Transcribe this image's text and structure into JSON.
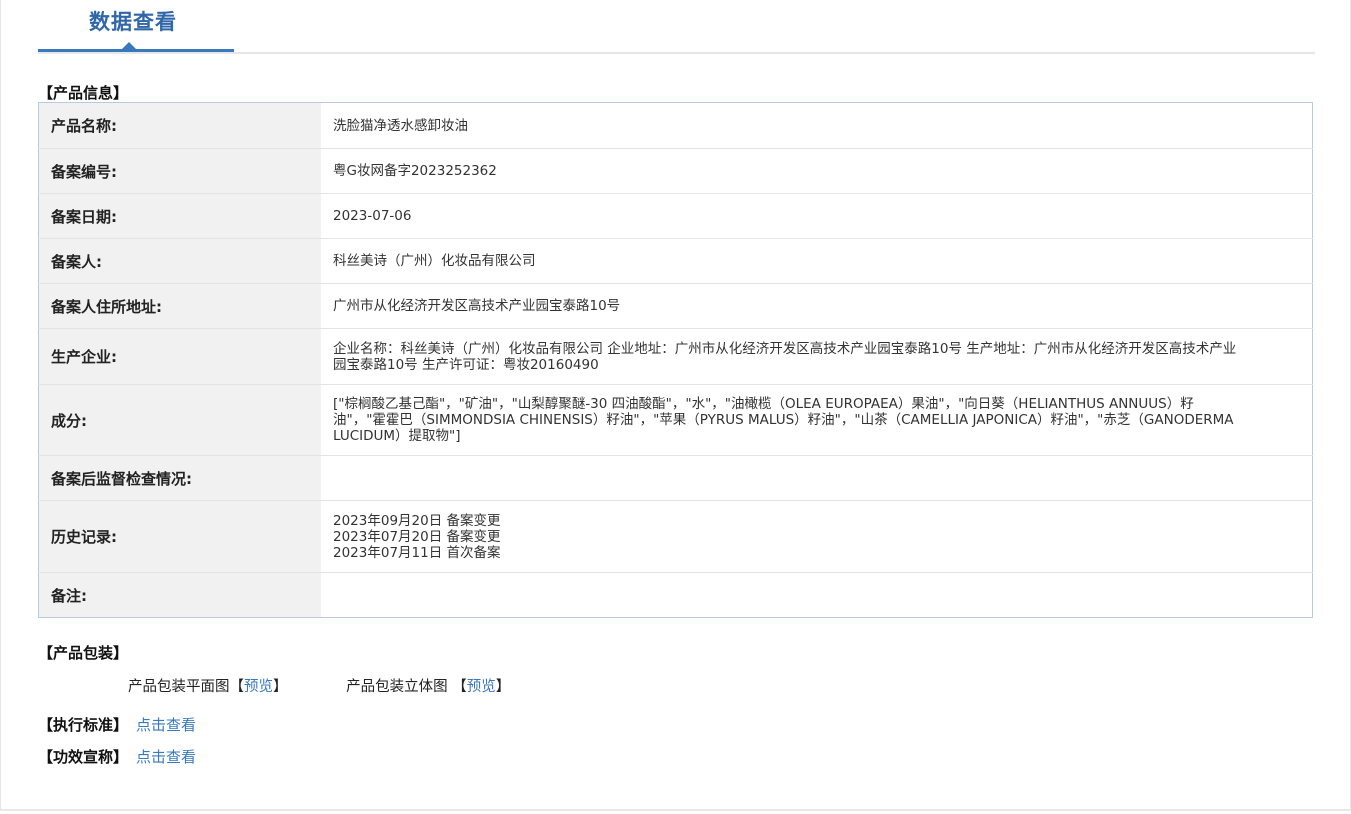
{
  "tab": {
    "title": "数据查看"
  },
  "product_info": {
    "heading": "【产品信息】",
    "rows": [
      {
        "label": "产品名称:",
        "value": "洗脸猫净透水感卸妆油",
        "height": 46
      },
      {
        "label": "备案编号:",
        "value": "粤G妆网备字2023252362",
        "height": 45
      },
      {
        "label": "备案日期:",
        "value": "2023-07-06",
        "height": 45
      },
      {
        "label": "备案人:",
        "value": "科丝美诗（广州）化妆品有限公司",
        "height": 45
      },
      {
        "label": "备案人住所地址:",
        "value": "广州市从化经济开发区高技术产业园宝泰路10号",
        "height": 45
      },
      {
        "label": "生产企业:",
        "value": "企业名称：科丝美诗（广州）化妆品有限公司 企业地址：广州市从化经济开发区高技术产业园宝泰路10号 生产地址：广州市从化经济开发区高技术产业园宝泰路10号 生产许可证：粤妆20160490",
        "height": 56
      },
      {
        "label": "成分:",
        "value": "[\"棕榈酸乙基己酯\"，\"矿油\"，\"山梨醇聚醚-30 四油酸酯\"，\"水\"，\"油橄榄（OLEA EUROPAEA）果油\"，\"向日葵（HELIANTHUS ANNUUS）籽油\"，\"霍霍巴（SIMMONDSIA CHINENSIS）籽油\"，\"苹果（PYRUS MALUS）籽油\"，\"山茶（CAMELLIA JAPONICA）籽油\"，\"赤芝（GANODERMA LUCIDUM）提取物\"]",
        "height": 71
      },
      {
        "label": "备案后监督检查情况:",
        "value": "",
        "height": 45
      },
      {
        "label": "历史记录:",
        "lines": [
          "2023年09月20日 备案变更",
          "2023年07月20日 备案变更",
          "2023年07月11日 首次备案"
        ],
        "height": 72
      },
      {
        "label": "备注:",
        "value": "",
        "height": 45
      }
    ]
  },
  "packaging": {
    "heading": "【产品包装】",
    "flat_label": "产品包装平面图",
    "flat_link": "预览",
    "stereo_label": "产品包装立体图 ",
    "stereo_link": "预览",
    "bracket_open": "【",
    "bracket_close": "】"
  },
  "standard": {
    "label": "【执行标准】",
    "link": "点击查看"
  },
  "claim": {
    "label": "【功效宣称】",
    "link": "点击查看"
  },
  "colors": {
    "accent": "#3a78bd",
    "title": "#2f67a8",
    "label_bg": "#f1f1f1",
    "table_border": "#b7cbe0"
  }
}
